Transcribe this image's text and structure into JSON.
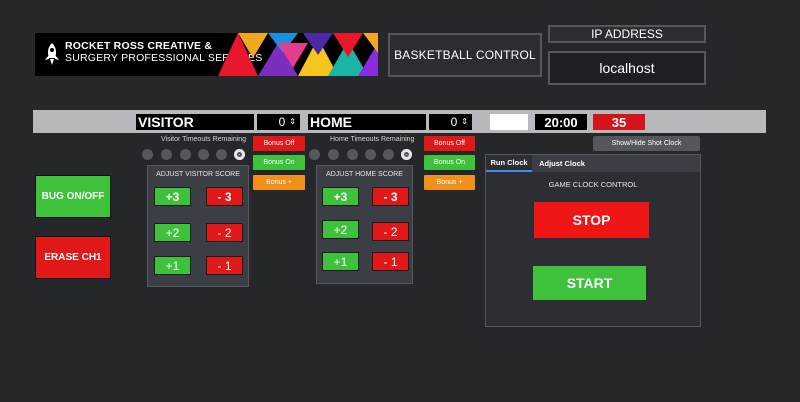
{
  "logo": {
    "line1_bold": "ROCKET",
    "line1_rest": "ROSS CREATIVE &",
    "line2_a": "SURGERY",
    "line2_b": "PROFESSIONAL SERVICES"
  },
  "header": {
    "title": "BASKETBALL CONTROL",
    "ip_label": "IP ADDRESS",
    "ip_value": "localhost"
  },
  "scoreboard": {
    "visitor_name": "VISITOR",
    "visitor_score": "0",
    "home_name": "HOME",
    "home_score": "0",
    "spinner_glyph": "⇕",
    "game_clock": "20:00",
    "shot_clock": "35"
  },
  "visitor": {
    "timeouts_label": "Visitor Timeouts Remaining",
    "bonus_off": "Bonus Off",
    "bonus_on": "Bonus On",
    "bonus_plus": "Bonus +",
    "panel_title": "ADJUST VISITOR SCORE",
    "plus3": "+3",
    "minus3": "- 3",
    "plus2": "+2",
    "minus2": "- 2",
    "plus1": "+1",
    "minus1": "- 1"
  },
  "home": {
    "timeouts_label": "Home Timeouts Remaining",
    "bonus_off": "Bonus Off",
    "bonus_on": "Bonus On",
    "bonus_plus": "Bonus +",
    "panel_title": "ADJUST HOME SCORE",
    "plus3": "+3",
    "minus3": "- 3",
    "plus2": "+2",
    "minus2": "- 2",
    "plus1": "+1",
    "minus1": "- 1"
  },
  "left_buttons": {
    "bug": "BUG ON/OFF",
    "erase": "ERASE CH1"
  },
  "clock_panel": {
    "show_hide": "Show/Hide Shot Clock",
    "tab_run": "Run Clock",
    "tab_adjust": "Adjust Clock",
    "label": "GAME CLOCK CONTROL",
    "stop": "STOP",
    "start": "START"
  },
  "colors": {
    "red": "#e01818",
    "green": "#3ec23c",
    "orange": "#f0901a",
    "background": "#26272b",
    "tab_accent": "#3d8ef0"
  }
}
